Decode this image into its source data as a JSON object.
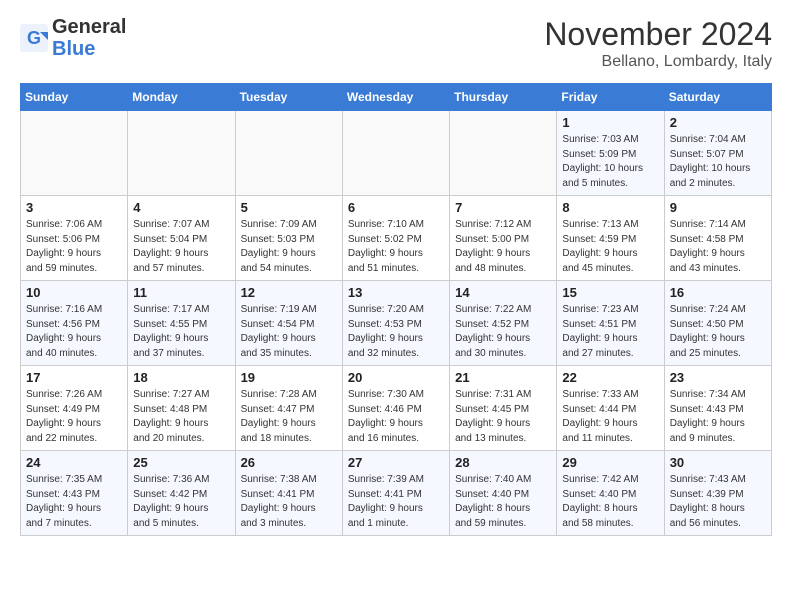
{
  "header": {
    "logo_line1": "General",
    "logo_line2": "Blue",
    "month": "November 2024",
    "location": "Bellano, Lombardy, Italy"
  },
  "weekdays": [
    "Sunday",
    "Monday",
    "Tuesday",
    "Wednesday",
    "Thursday",
    "Friday",
    "Saturday"
  ],
  "weeks": [
    [
      {
        "day": "",
        "info": ""
      },
      {
        "day": "",
        "info": ""
      },
      {
        "day": "",
        "info": ""
      },
      {
        "day": "",
        "info": ""
      },
      {
        "day": "",
        "info": ""
      },
      {
        "day": "1",
        "info": "Sunrise: 7:03 AM\nSunset: 5:09 PM\nDaylight: 10 hours\nand 5 minutes."
      },
      {
        "day": "2",
        "info": "Sunrise: 7:04 AM\nSunset: 5:07 PM\nDaylight: 10 hours\nand 2 minutes."
      }
    ],
    [
      {
        "day": "3",
        "info": "Sunrise: 7:06 AM\nSunset: 5:06 PM\nDaylight: 9 hours\nand 59 minutes."
      },
      {
        "day": "4",
        "info": "Sunrise: 7:07 AM\nSunset: 5:04 PM\nDaylight: 9 hours\nand 57 minutes."
      },
      {
        "day": "5",
        "info": "Sunrise: 7:09 AM\nSunset: 5:03 PM\nDaylight: 9 hours\nand 54 minutes."
      },
      {
        "day": "6",
        "info": "Sunrise: 7:10 AM\nSunset: 5:02 PM\nDaylight: 9 hours\nand 51 minutes."
      },
      {
        "day": "7",
        "info": "Sunrise: 7:12 AM\nSunset: 5:00 PM\nDaylight: 9 hours\nand 48 minutes."
      },
      {
        "day": "8",
        "info": "Sunrise: 7:13 AM\nSunset: 4:59 PM\nDaylight: 9 hours\nand 45 minutes."
      },
      {
        "day": "9",
        "info": "Sunrise: 7:14 AM\nSunset: 4:58 PM\nDaylight: 9 hours\nand 43 minutes."
      }
    ],
    [
      {
        "day": "10",
        "info": "Sunrise: 7:16 AM\nSunset: 4:56 PM\nDaylight: 9 hours\nand 40 minutes."
      },
      {
        "day": "11",
        "info": "Sunrise: 7:17 AM\nSunset: 4:55 PM\nDaylight: 9 hours\nand 37 minutes."
      },
      {
        "day": "12",
        "info": "Sunrise: 7:19 AM\nSunset: 4:54 PM\nDaylight: 9 hours\nand 35 minutes."
      },
      {
        "day": "13",
        "info": "Sunrise: 7:20 AM\nSunset: 4:53 PM\nDaylight: 9 hours\nand 32 minutes."
      },
      {
        "day": "14",
        "info": "Sunrise: 7:22 AM\nSunset: 4:52 PM\nDaylight: 9 hours\nand 30 minutes."
      },
      {
        "day": "15",
        "info": "Sunrise: 7:23 AM\nSunset: 4:51 PM\nDaylight: 9 hours\nand 27 minutes."
      },
      {
        "day": "16",
        "info": "Sunrise: 7:24 AM\nSunset: 4:50 PM\nDaylight: 9 hours\nand 25 minutes."
      }
    ],
    [
      {
        "day": "17",
        "info": "Sunrise: 7:26 AM\nSunset: 4:49 PM\nDaylight: 9 hours\nand 22 minutes."
      },
      {
        "day": "18",
        "info": "Sunrise: 7:27 AM\nSunset: 4:48 PM\nDaylight: 9 hours\nand 20 minutes."
      },
      {
        "day": "19",
        "info": "Sunrise: 7:28 AM\nSunset: 4:47 PM\nDaylight: 9 hours\nand 18 minutes."
      },
      {
        "day": "20",
        "info": "Sunrise: 7:30 AM\nSunset: 4:46 PM\nDaylight: 9 hours\nand 16 minutes."
      },
      {
        "day": "21",
        "info": "Sunrise: 7:31 AM\nSunset: 4:45 PM\nDaylight: 9 hours\nand 13 minutes."
      },
      {
        "day": "22",
        "info": "Sunrise: 7:33 AM\nSunset: 4:44 PM\nDaylight: 9 hours\nand 11 minutes."
      },
      {
        "day": "23",
        "info": "Sunrise: 7:34 AM\nSunset: 4:43 PM\nDaylight: 9 hours\nand 9 minutes."
      }
    ],
    [
      {
        "day": "24",
        "info": "Sunrise: 7:35 AM\nSunset: 4:43 PM\nDaylight: 9 hours\nand 7 minutes."
      },
      {
        "day": "25",
        "info": "Sunrise: 7:36 AM\nSunset: 4:42 PM\nDaylight: 9 hours\nand 5 minutes."
      },
      {
        "day": "26",
        "info": "Sunrise: 7:38 AM\nSunset: 4:41 PM\nDaylight: 9 hours\nand 3 minutes."
      },
      {
        "day": "27",
        "info": "Sunrise: 7:39 AM\nSunset: 4:41 PM\nDaylight: 9 hours\nand 1 minute."
      },
      {
        "day": "28",
        "info": "Sunrise: 7:40 AM\nSunset: 4:40 PM\nDaylight: 8 hours\nand 59 minutes."
      },
      {
        "day": "29",
        "info": "Sunrise: 7:42 AM\nSunset: 4:40 PM\nDaylight: 8 hours\nand 58 minutes."
      },
      {
        "day": "30",
        "info": "Sunrise: 7:43 AM\nSunset: 4:39 PM\nDaylight: 8 hours\nand 56 minutes."
      }
    ]
  ]
}
